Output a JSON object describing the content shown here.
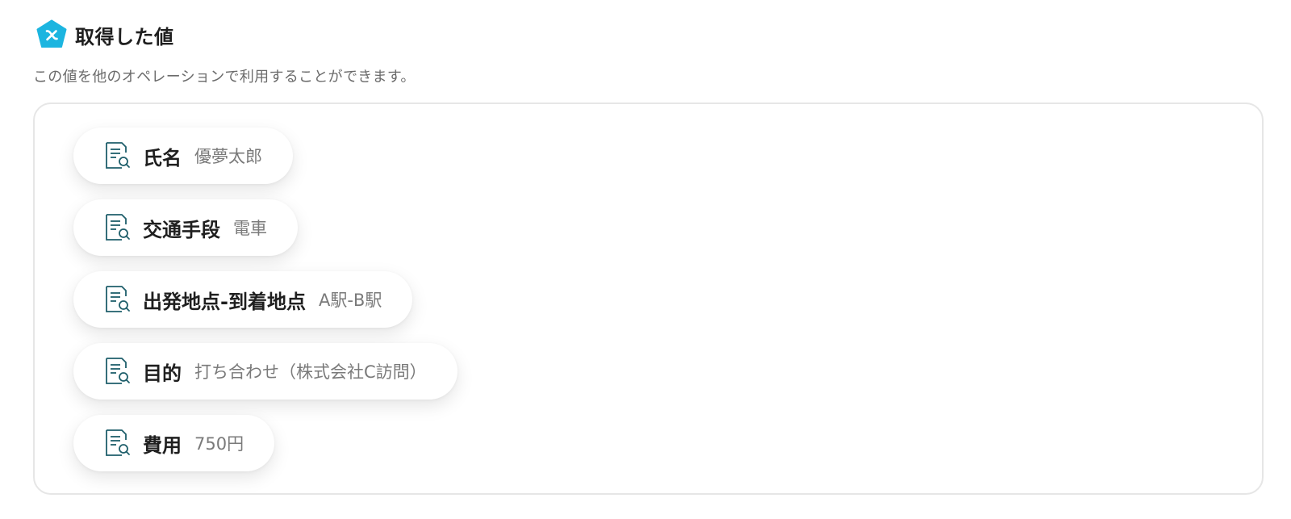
{
  "header": {
    "icon": "brand-pentagon-icon",
    "title": "取得した値"
  },
  "description": "この値を他のオペレーションで利用することができます。",
  "colors": {
    "brand": "#1cb5e0",
    "chip_icon": "#1f5f6b"
  },
  "values": [
    {
      "label": "氏名",
      "value": "優夢太郎",
      "icon": "document-search-icon"
    },
    {
      "label": "交通手段",
      "value": "電車",
      "icon": "document-search-icon"
    },
    {
      "label": "出発地点-到着地点",
      "value": "A駅-B駅",
      "icon": "document-search-icon"
    },
    {
      "label": "目的",
      "value": "打ち合わせ（株式会社C訪問）",
      "icon": "document-search-icon"
    },
    {
      "label": "費用",
      "value": "750円",
      "icon": "document-search-icon"
    }
  ]
}
